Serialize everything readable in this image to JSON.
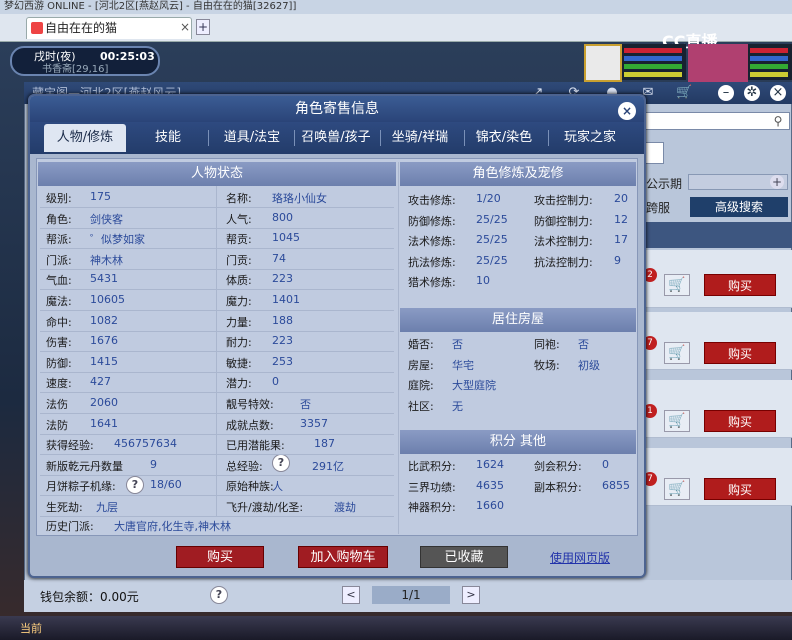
{
  "browser": {
    "top_strip": "梦幻西游 ONLINE - [河北2区[燕赵风云] - 自由在在的猫[32627]]",
    "tab_title": "自由在在的猫",
    "tab_close": "×",
    "tab_add": "+"
  },
  "game_hud": {
    "time_label": "戌时(夜)",
    "clock": "00:25:03",
    "location": "书香斋[29,16]",
    "cc_logo": "CC直播"
  },
  "behind_window": {
    "title": "藏宝阁—河北2区[燕赵风云]",
    "show_label": "公示期",
    "cross_label": "跨服",
    "senior_search": "高级搜索",
    "buy": "购买",
    "badges": [
      "2",
      "7",
      "1",
      "7"
    ]
  },
  "dialog": {
    "title": "角色寄售信息",
    "close": "×",
    "tabs": [
      "人物/修炼",
      "技能",
      "道具/法宝",
      "召唤兽/孩子",
      "坐骑/祥瑞",
      "锦衣/染色",
      "玩家之家"
    ],
    "left_header": "人物状态",
    "left_rows": [
      {
        "l1": "级别:",
        "v1": "175",
        "l2": "名称:",
        "v2": "珞珞小仙女"
      },
      {
        "l1": "角色:",
        "v1": "剑侠客",
        "l2": "人气:",
        "v2": "800"
      },
      {
        "l1": "帮派:",
        "v1": "゜似梦如家",
        "l2": "帮贡:",
        "v2": "1045"
      },
      {
        "l1": "门派:",
        "v1": "神木林",
        "l2": "门贡:",
        "v2": "74"
      },
      {
        "l1": "气血:",
        "v1": "5431",
        "l2": "体质:",
        "v2": "223"
      },
      {
        "l1": "魔法:",
        "v1": "10605",
        "l2": "魔力:",
        "v2": "1401"
      },
      {
        "l1": "命中:",
        "v1": "1082",
        "l2": "力量:",
        "v2": "188"
      },
      {
        "l1": "伤害:",
        "v1": "1676",
        "l2": "耐力:",
        "v2": "223"
      },
      {
        "l1": "防御:",
        "v1": "1415",
        "l2": "敏捷:",
        "v2": "253"
      },
      {
        "l1": "速度:",
        "v1": "427",
        "l2": "潜力:",
        "v2": "0"
      },
      {
        "l1": "法伤",
        "v1": "2060",
        "l2": "靓号特效:",
        "v2": "否"
      },
      {
        "l1": "法防",
        "v1": "1641",
        "l2": "成就点数:",
        "v2": "3357"
      },
      {
        "l1": "获得经验:",
        "v1": "456757634",
        "l2": "已用潜能果:",
        "v2": "187"
      },
      {
        "l1": "新版乾元丹数量",
        "v1": "9",
        "l2": "总经验:",
        "v2": "291亿"
      },
      {
        "l1": "月饼粽子机缘:",
        "v1": "18/60",
        "l2": "原始种族:",
        "v2": "人"
      },
      {
        "l1": "生死劫:",
        "v1": "九层",
        "l2": "飞升/渡劫/化圣:",
        "v2": "渡劫"
      }
    ],
    "history_label": "历史门派:",
    "history_value": "大唐官府,化生寺,神木林",
    "cult_header": "角色修炼及宠修",
    "cult_rows": [
      {
        "l1": "攻击修炼:",
        "v1": "1/20",
        "l2": "攻击控制力:",
        "v2": "20"
      },
      {
        "l1": "防御修炼:",
        "v1": "25/25",
        "l2": "防御控制力:",
        "v2": "12"
      },
      {
        "l1": "法术修炼:",
        "v1": "25/25",
        "l2": "法术控制力:",
        "v2": "17"
      },
      {
        "l1": "抗法修炼:",
        "v1": "25/25",
        "l2": "抗法控制力:",
        "v2": "9"
      },
      {
        "l1": "猎术修炼:",
        "v1": "10",
        "l2": "",
        "v2": ""
      }
    ],
    "house_header": "居住房屋",
    "house_rows": [
      {
        "l1": "婚否:",
        "v1": "否",
        "l2": "同袍:",
        "v2": "否"
      },
      {
        "l1": "房屋:",
        "v1": "华宅",
        "l2": "牧场:",
        "v2": "初级"
      },
      {
        "l1": "庭院:",
        "v1": "大型庭院",
        "l2": "",
        "v2": ""
      },
      {
        "l1": "社区:",
        "v1": "无",
        "l2": "",
        "v2": ""
      }
    ],
    "score_header": "积分 其他",
    "score_rows": [
      {
        "l1": "比武积分:",
        "v1": "1624",
        "l2": "剑会积分:",
        "v2": "0"
      },
      {
        "l1": "三界功绩:",
        "v1": "4635",
        "l2": "副本积分:",
        "v2": "6855"
      },
      {
        "l1": "神器积分:",
        "v1": "1660",
        "l2": "",
        "v2": ""
      }
    ],
    "btn_buy": "购买",
    "btn_cart": "加入购物车",
    "btn_fav": "已收藏",
    "link_web": "使用网页版"
  },
  "footer": {
    "wallet": "钱包余额：0.00元",
    "page": "1/1",
    "prev": "<",
    "next": ">",
    "taskbar_cur": "当前"
  }
}
